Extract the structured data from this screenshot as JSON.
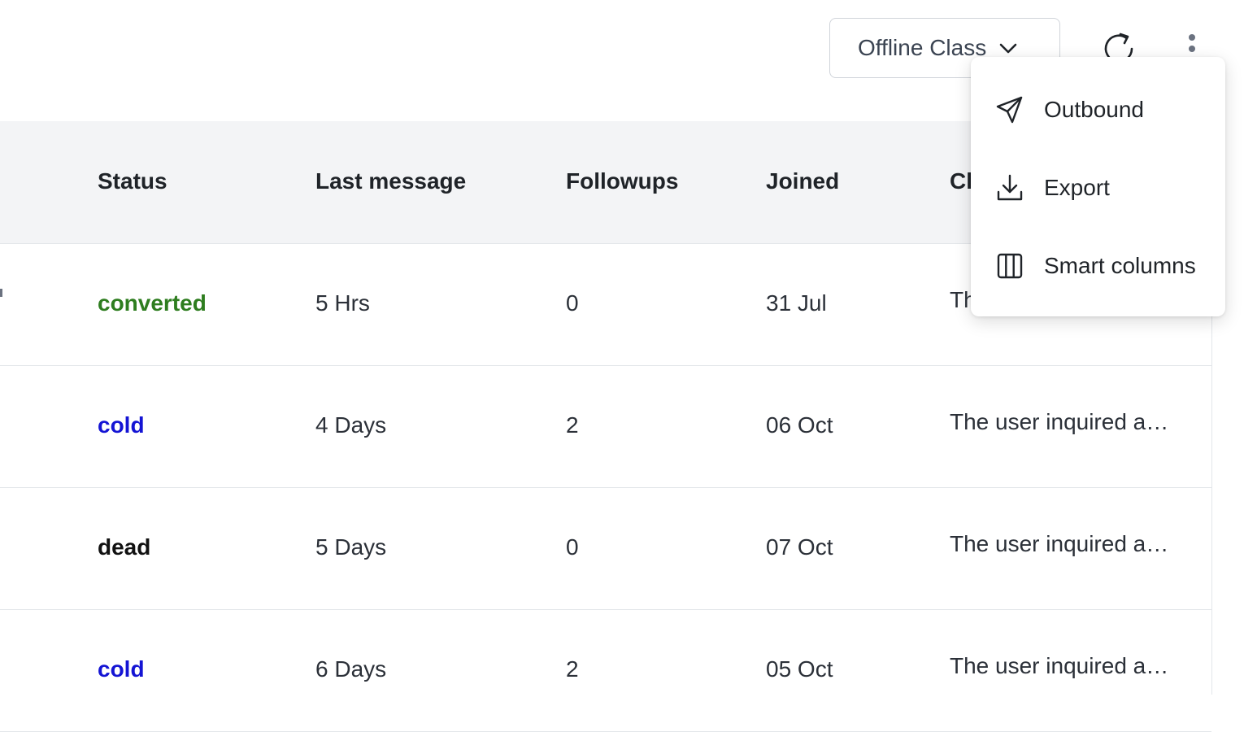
{
  "toolbar": {
    "dropdown_label": "Offline Class",
    "dropdown_icon": "chevron-down-icon",
    "refresh_icon": "refresh-icon",
    "more_icon": "more-vertical-icon"
  },
  "table": {
    "columns": {
      "status": "Status",
      "last_message": "Last message",
      "followups": "Followups",
      "joined": "Joined",
      "summary_partial": "Cl"
    },
    "rows": [
      {
        "status": "converted",
        "status_color": "#2e7d1f",
        "last_message": "5 Hrs",
        "followups": "0",
        "joined": "31 Jul",
        "summary": "Th"
      },
      {
        "status": "cold",
        "status_color": "#1414d4",
        "last_message": "4 Days",
        "followups": "2",
        "joined": "06 Oct",
        "summary": "The user inquired a…"
      },
      {
        "status": "dead",
        "status_color": "#111111",
        "last_message": "5 Days",
        "followups": "0",
        "joined": "07 Oct",
        "summary": "The user inquired a…"
      },
      {
        "status": "cold",
        "status_color": "#1414d4",
        "last_message": "6 Days",
        "followups": "2",
        "joined": "05 Oct",
        "summary": "The user inquired a…"
      }
    ]
  },
  "menu": {
    "items": [
      {
        "label": "Outbound",
        "icon": "send-icon"
      },
      {
        "label": "Export",
        "icon": "download-icon"
      },
      {
        "label": "Smart columns",
        "icon": "columns-icon"
      }
    ]
  },
  "colors": {
    "header_bg": "#f3f4f6",
    "border": "#e3e6ea",
    "status_converted": "#2e7d1f",
    "status_cold": "#1414d4",
    "status_dead": "#111111"
  }
}
